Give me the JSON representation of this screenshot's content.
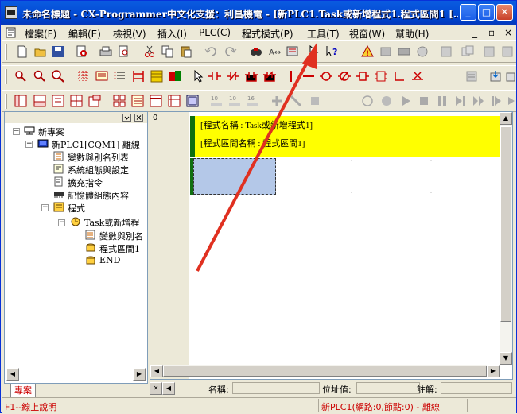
{
  "window": {
    "title": "未命名標題 - CX-Programmer中文化支援：利昌機電 - [新PLC1.Task或新增程式1.程式區間1 [...",
    "minimize_glyph": "_",
    "maximize_glyph": "□",
    "close_glyph": "✕"
  },
  "menu": {
    "items": [
      "檔案(F)",
      "編輯(E)",
      "檢視(V)",
      "插入(I)",
      "PLC(C)",
      "程式模式(P)",
      "工具(T)",
      "視窗(W)",
      "幫助(H)"
    ],
    "child_controls": [
      "_",
      "▫",
      "×"
    ]
  },
  "toolbars": {
    "row1_icons": [
      "new-icon",
      "open-icon",
      "save-icon",
      "print-preview-icon",
      "print-icon",
      "preview-icon",
      "cut-icon",
      "copy-icon",
      "paste-icon",
      "undo-icon",
      "redo-icon",
      "find-icon",
      "replace-icon",
      "cross-ref-icon",
      "pointer-icon",
      "help-pointer-icon",
      "warning-icon",
      "compile-icon",
      "online-icon",
      "monitor-icon",
      "transfer-icon",
      "compare-icon"
    ],
    "row2_icons": [
      "zoom-icon",
      "zoom-in-icon",
      "zoom-out-icon",
      "grid-icon",
      "comment-icon",
      "list-icon",
      "rung-icon",
      "io-table-icon",
      "memory-icon",
      "select-icon",
      "contact-no-icon",
      "contact-nc-icon",
      "contact-or-icon",
      "contact-or-nc-icon",
      "vline-icon",
      "hline-icon",
      "coil-icon",
      "coil-nc-icon",
      "instruction-icon",
      "fb-icon",
      "line-draw-icon",
      "delete-line-icon",
      "mode-icon",
      "settings-icon"
    ],
    "row3_icons": [
      "proj-workspace-icon",
      "output-icon",
      "watch-icon",
      "address-ref-icon",
      "properties-icon",
      "symbols-icon",
      "cross-ref-report-icon",
      "view-icon",
      "mem-window-icon",
      "hex-10-icon",
      "hex-10b-icon",
      "hex-16-icon",
      "force-on-icon",
      "force-off-icon",
      "stop-icon",
      "play-icon",
      "pause-icon",
      "step-icon",
      "step-over-icon",
      "step-out-icon"
    ],
    "hex_labels": [
      "10",
      "10",
      "16"
    ]
  },
  "project_tree": {
    "tab_label": "專案",
    "items": [
      {
        "label": "新專案",
        "icon": "project-icon"
      },
      {
        "label": "新PLC1[CQM1] 離線",
        "icon": "plc-icon"
      },
      {
        "label": "變數與別名列表",
        "icon": "symbols-table-icon"
      },
      {
        "label": "系統組態與設定",
        "icon": "settings-icon"
      },
      {
        "label": "擴充指令",
        "icon": "expansion-icon"
      },
      {
        "label": "記憶體組態內容",
        "icon": "memory-icon"
      },
      {
        "label": "程式",
        "icon": "programs-icon"
      },
      {
        "label": "Task或新增程",
        "icon": "task-icon"
      },
      {
        "label": "變數與別名",
        "icon": "symbols-icon"
      },
      {
        "label": "程式區間1",
        "icon": "section-icon"
      },
      {
        "label": "END",
        "icon": "end-section-icon"
      }
    ]
  },
  "ladder": {
    "rung_number": "0",
    "program_name_label": "[程式名稱 : Task或新增程式1]",
    "section_name_label": "[程式區間名稱 : 程式區間1]",
    "highlight_color": "#ffff00",
    "cursor_color": "#b4c8e8"
  },
  "info_bar": {
    "name_label": "名稱:",
    "address_label": "位址值:",
    "comment_label": "註解:"
  },
  "status": {
    "left": "F1--線上說明",
    "right": "新PLC1(網路:0,節點:0) - 離線"
  },
  "accent_color": "#e03020"
}
